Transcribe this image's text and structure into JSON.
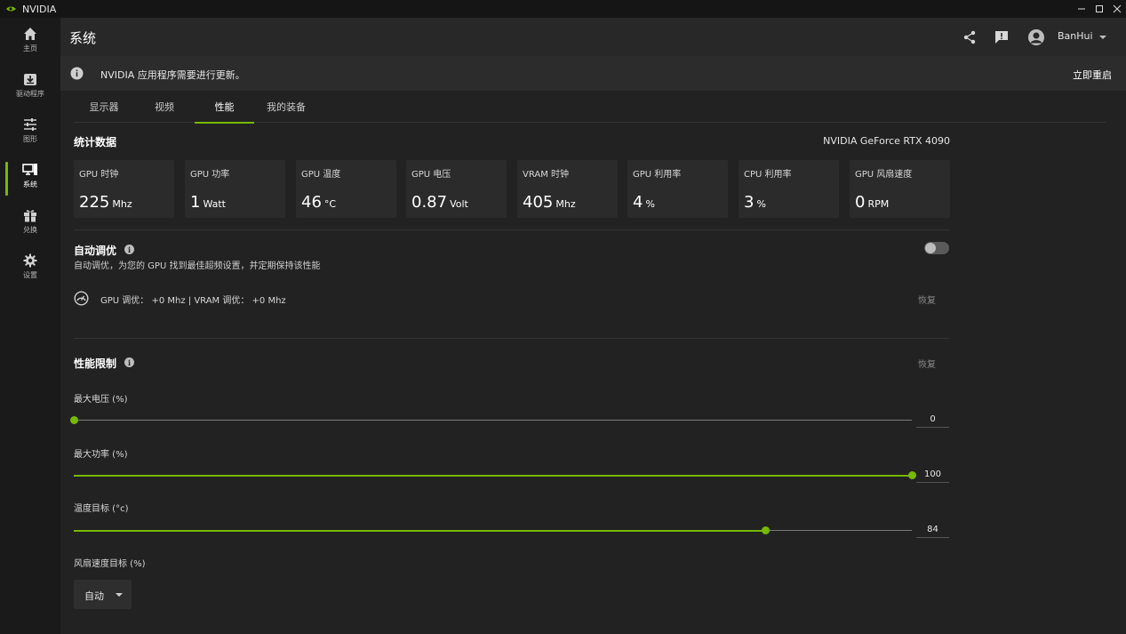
{
  "window": {
    "app_name": "NVIDIA"
  },
  "sidebar": {
    "items": [
      {
        "label": "主页",
        "icon": "home-icon",
        "active": false
      },
      {
        "label": "驱动程序",
        "icon": "driver-download-icon",
        "active": false
      },
      {
        "label": "图形",
        "icon": "sliders-icon",
        "active": false
      },
      {
        "label": "系统",
        "icon": "monitor-system-icon",
        "active": true
      },
      {
        "label": "兑换",
        "icon": "gift-icon",
        "active": false
      },
      {
        "label": "设置",
        "icon": "gear-icon",
        "active": false
      }
    ]
  },
  "header": {
    "title": "系统",
    "username": "BanHui"
  },
  "banner": {
    "message": "NVIDIA 应用程序需要进行更新。",
    "action": "立即重启"
  },
  "tabs": [
    {
      "label": "显示器",
      "active": false
    },
    {
      "label": "视频",
      "active": false
    },
    {
      "label": "性能",
      "active": true
    },
    {
      "label": "我的装备",
      "active": false
    }
  ],
  "stats": {
    "title": "统计数据",
    "gpu_name": "NVIDIA GeForce RTX 4090",
    "cards": [
      {
        "label": "GPU 时钟",
        "value": "225",
        "unit": "Mhz"
      },
      {
        "label": "GPU 功率",
        "value": "1",
        "unit": "Watt"
      },
      {
        "label": "GPU 温度",
        "value": "46",
        "unit": "°C"
      },
      {
        "label": "GPU 电压",
        "value": "0.87",
        "unit": "Volt"
      },
      {
        "label": "VRAM 时钟",
        "value": "405",
        "unit": "Mhz"
      },
      {
        "label": "GPU 利用率",
        "value": "4",
        "unit": "%"
      },
      {
        "label": "CPU 利用率",
        "value": "3",
        "unit": "%"
      },
      {
        "label": "GPU 风扇速度",
        "value": "0",
        "unit": "RPM"
      }
    ]
  },
  "auto_tune": {
    "title": "自动调优",
    "description": "自动调优，为您的 GPU 找到最佳超频设置，并定期保持该性能",
    "enabled": false,
    "status": "GPU 调优：  +0 Mhz   |  VRAM 调优：  +0 Mhz",
    "restore": "恢复"
  },
  "perf_limits": {
    "title": "性能限制",
    "restore": "恢复",
    "sliders": [
      {
        "label": "最大电压 (%)",
        "value": "0",
        "fraction": 0.0
      },
      {
        "label": "最大功率 (%)",
        "value": "100",
        "fraction": 1.0
      },
      {
        "label": "温度目标 (°c)",
        "value": "84",
        "fraction": 0.826
      }
    ],
    "fan": {
      "label": "风扇速度目标 (%)",
      "selected": "自动"
    }
  },
  "colors": {
    "accent": "#76b900",
    "background": "#222222",
    "sidebar": "#1a1a1a"
  }
}
